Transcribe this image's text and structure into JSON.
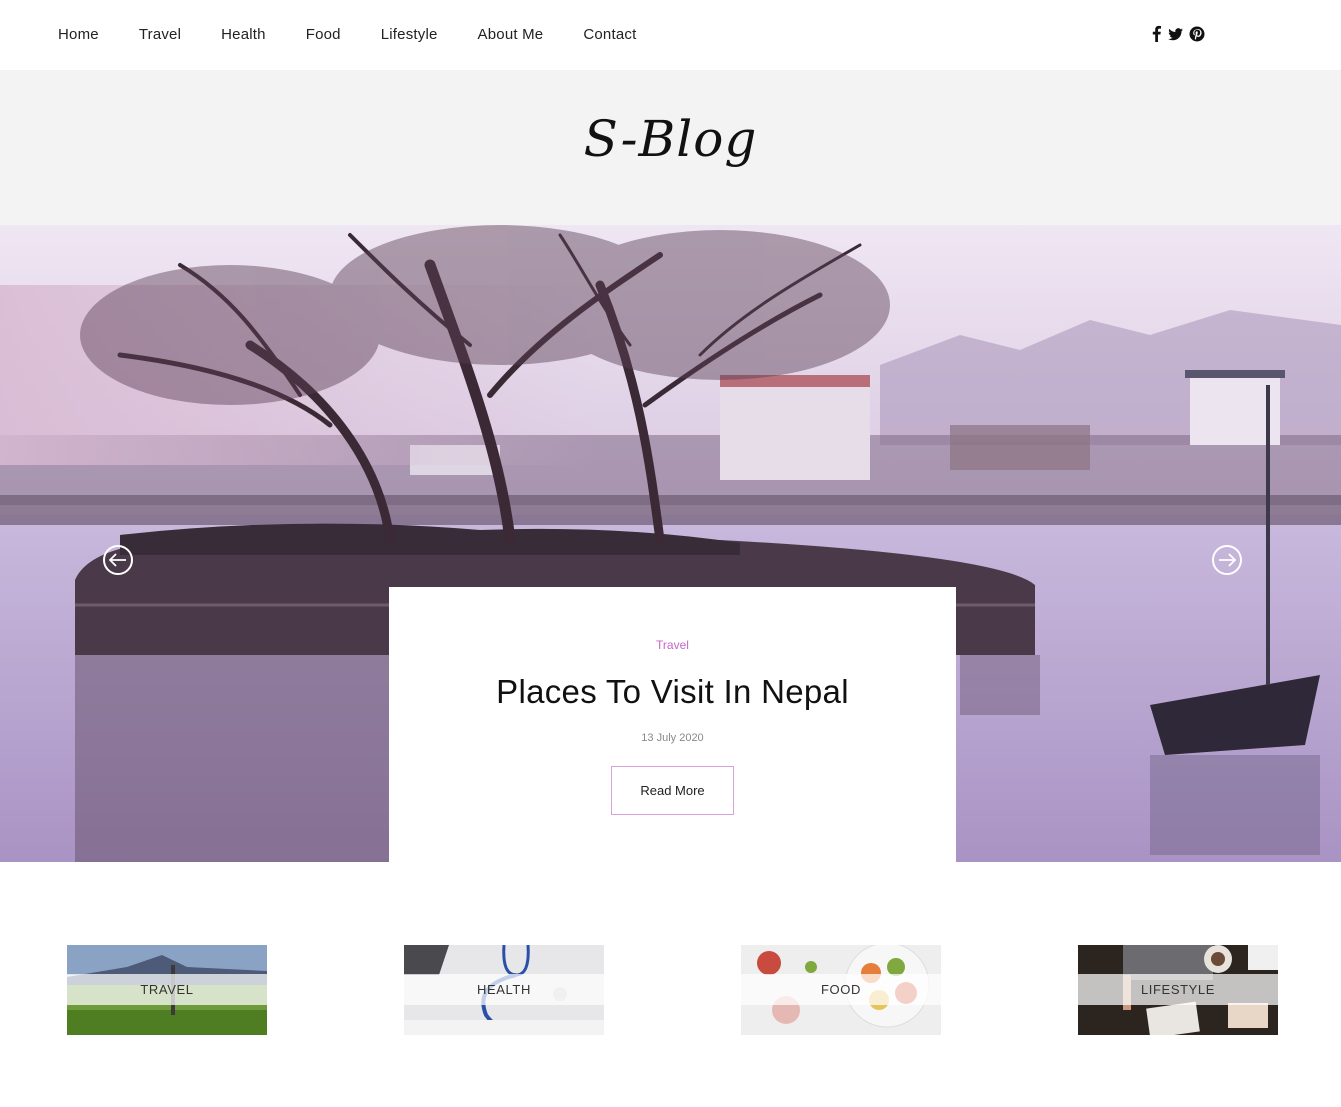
{
  "nav": {
    "links": [
      "Home",
      "Travel",
      "Health",
      "Food",
      "Lifestyle",
      "About Me",
      "Contact"
    ],
    "social_icons": [
      "facebook-icon",
      "twitter-icon",
      "pinterest-icon"
    ]
  },
  "brand": {
    "logo_text": "S-Blog"
  },
  "hero": {
    "category": "Travel",
    "title": "Places To Visit In Nepal",
    "date": "13 July 2020",
    "button_label": "Read More",
    "prev_icon": "arrow-left-icon",
    "next_icon": "arrow-right-icon"
  },
  "categories": [
    {
      "label": "TRAVEL"
    },
    {
      "label": "HEALTH"
    },
    {
      "label": "FOOD"
    },
    {
      "label": "LIFESTYLE"
    }
  ],
  "colors": {
    "accent": "#c467c9",
    "button_border": "#d9a1dc",
    "band": "#f3f3f3"
  }
}
